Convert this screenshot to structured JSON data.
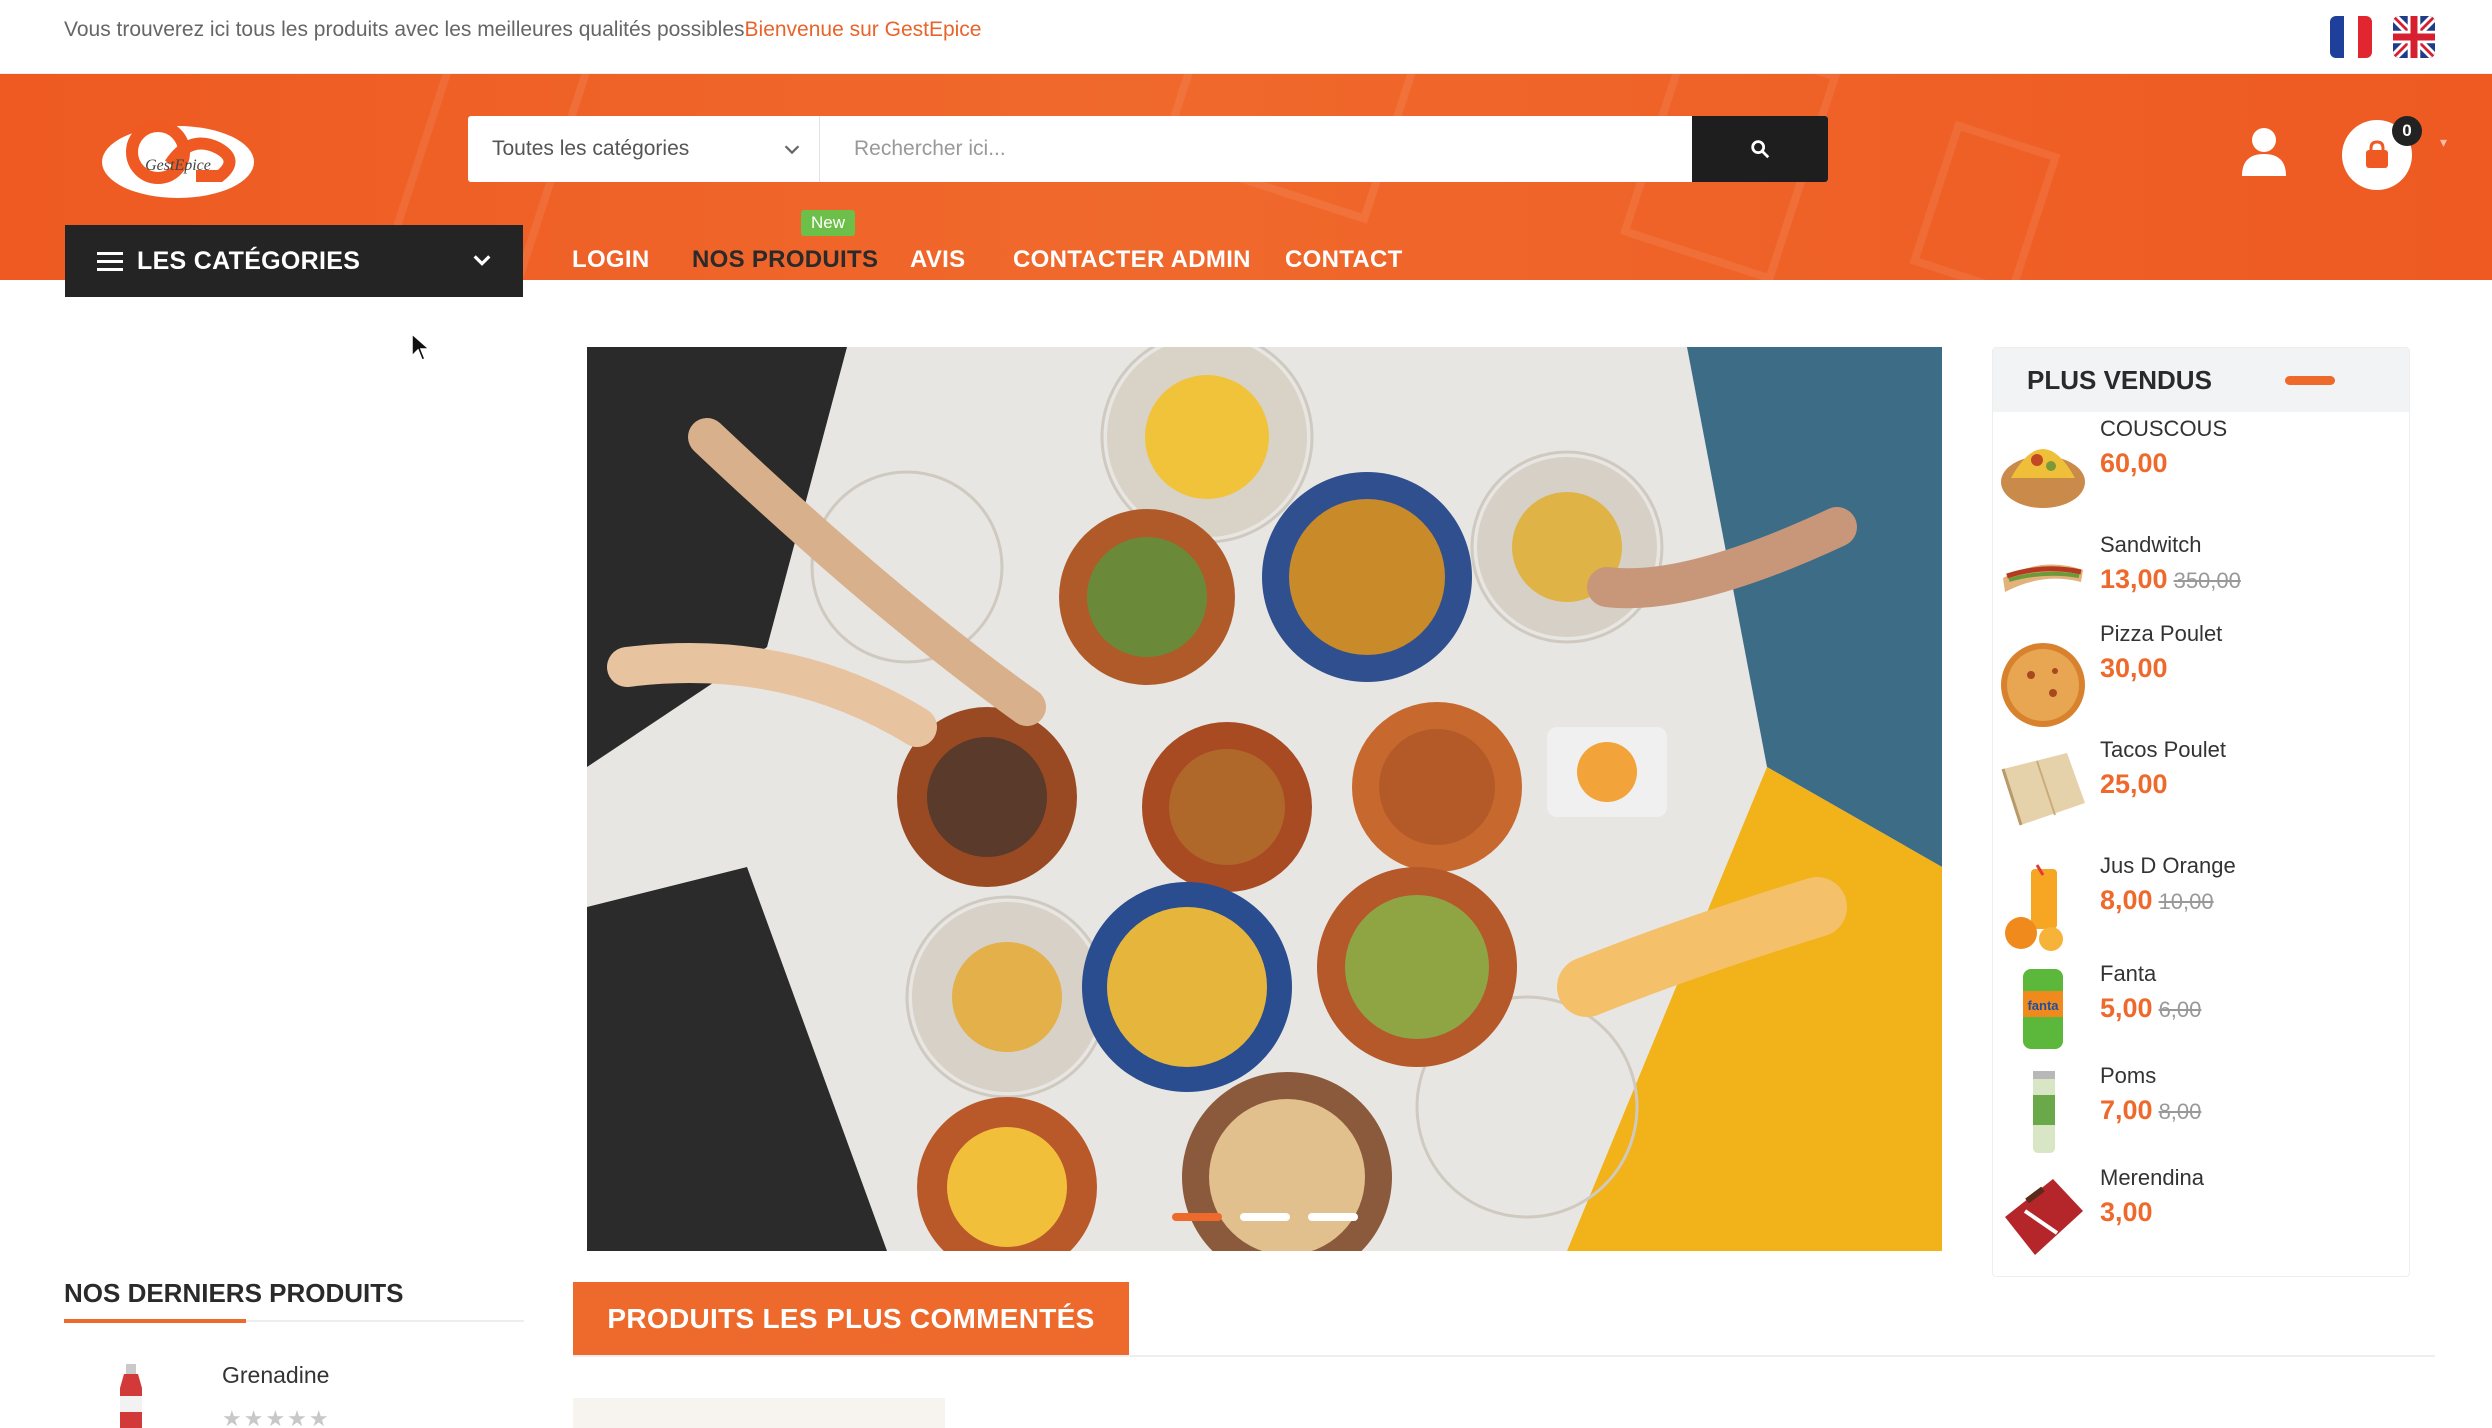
{
  "topbar": {
    "message": "Vous trouverez ici tous les produits avec les meilleures qualités possibles",
    "welcome": "Bienvenue sur GestEpice"
  },
  "languages": [
    "fr-flag-icon",
    "uk-flag-icon"
  ],
  "logo": {
    "text": "GestEpice"
  },
  "search": {
    "category_selected": "Toutes les catégories",
    "placeholder": "Rechercher ici..."
  },
  "cart": {
    "count": "0"
  },
  "categories_button": {
    "label": "LES CATÉGORIES"
  },
  "nav": {
    "items": [
      "LOGIN",
      "NOS PRODUITS",
      "AVIS",
      "CONTACTER ADMIN",
      "CONTACT"
    ],
    "new_badge": "New"
  },
  "hero": {
    "slides": 3,
    "active_slide": 1
  },
  "best_sellers": {
    "title": "PLUS VENDUS",
    "items": [
      {
        "name": "COUSCOUS",
        "price": "60,00",
        "old_price": ""
      },
      {
        "name": "Sandwitch",
        "price": "13,00",
        "old_price": "350,00"
      },
      {
        "name": "Pizza Poulet",
        "price": "30,00",
        "old_price": ""
      },
      {
        "name": "Tacos Poulet",
        "price": "25,00",
        "old_price": ""
      },
      {
        "name": "Jus D Orange",
        "price": "8,00",
        "old_price": "10,00"
      },
      {
        "name": "Fanta",
        "price": "5,00",
        "old_price": "6,00"
      },
      {
        "name": "Poms",
        "price": "7,00",
        "old_price": "8,00"
      },
      {
        "name": "Merendina",
        "price": "3,00",
        "old_price": ""
      }
    ]
  },
  "latest_products": {
    "title": "NOS DERNIERS PRODUITS",
    "items": [
      {
        "name": "Grenadine",
        "rating": 0,
        "stars": "★★★★★"
      }
    ]
  },
  "most_commented": {
    "label": "PRODUITS LES PLUS COMMENTÉS"
  },
  "colors": {
    "accent": "#ee6a2c",
    "dark": "#242424",
    "badge": "#6cc04a"
  }
}
